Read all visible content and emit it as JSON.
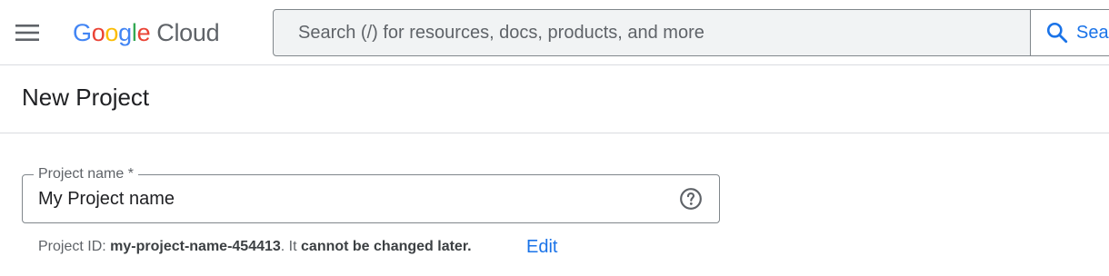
{
  "header": {
    "logo": {
      "letters": [
        "G",
        "o",
        "o",
        "g",
        "l",
        "e"
      ],
      "product": "Cloud"
    },
    "menu_icon": "hamburger-menu-icon",
    "search": {
      "placeholder": "Search (/) for resources, docs, products, and more",
      "value": "",
      "button_label": "Search",
      "button_icon": "search-icon"
    }
  },
  "page": {
    "title": "New Project"
  },
  "form": {
    "project_name": {
      "label": "Project name *",
      "value": "My Project name",
      "help_icon": "help-circle-icon"
    },
    "project_id_hint": {
      "prefix": "Project ID:",
      "id": "my-project-name-454413",
      "middle": ". It",
      "emphasis": "cannot be changed later.",
      "edit_label": "Edit"
    }
  },
  "colors": {
    "accent": "#1a73e8",
    "border": "#dadce0",
    "search_bg": "#f1f3f4",
    "google_blue": "#4285f4",
    "google_red": "#ea4335",
    "google_yellow": "#fbbc04",
    "google_green": "#34a853"
  }
}
